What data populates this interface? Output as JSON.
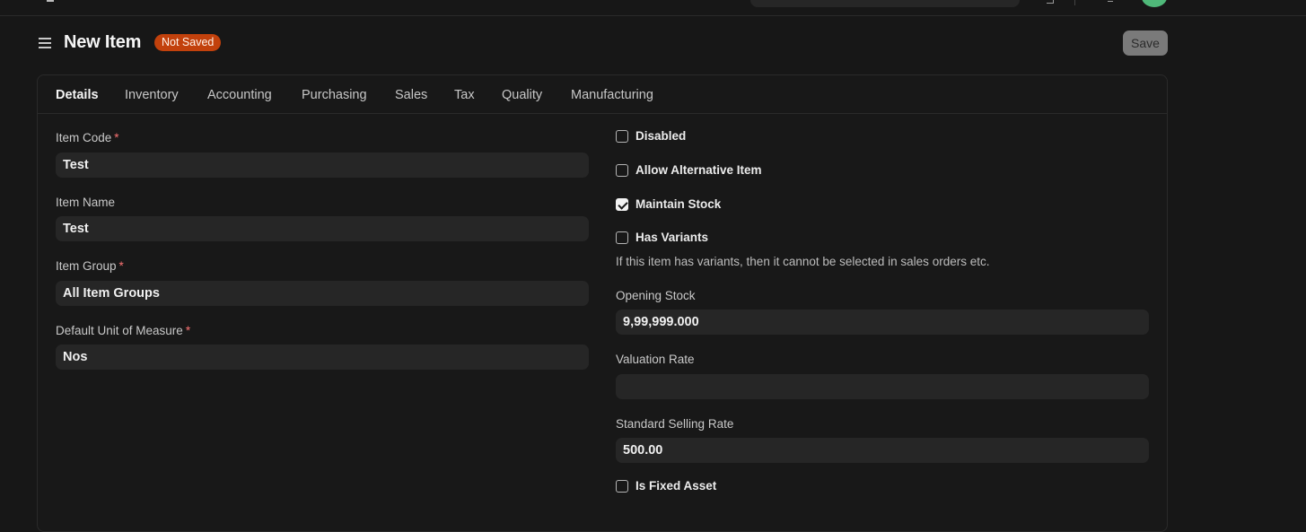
{
  "header": {
    "title": "New Item",
    "status": "Not Saved",
    "save_label": "Save"
  },
  "tabs": [
    {
      "label": "Details",
      "active": true
    },
    {
      "label": "Inventory"
    },
    {
      "label": "Accounting"
    },
    {
      "label": "Purchasing"
    },
    {
      "label": "Sales"
    },
    {
      "label": "Tax"
    },
    {
      "label": "Quality"
    },
    {
      "label": "Manufacturing"
    }
  ],
  "left_fields": {
    "item_code": {
      "label": "Item Code",
      "value": "Test",
      "required": "*"
    },
    "item_name": {
      "label": "Item Name",
      "value": "Test"
    },
    "item_group": {
      "label": "Item Group",
      "value": "All Item Groups",
      "required": "*"
    },
    "uom": {
      "label": "Default Unit of Measure",
      "value": "Nos",
      "required": "*"
    }
  },
  "right_fields": {
    "disabled": {
      "label": "Disabled",
      "checked": false
    },
    "allow_alternative": {
      "label": "Allow Alternative Item",
      "checked": false
    },
    "maintain_stock": {
      "label": "Maintain Stock",
      "checked": true
    },
    "has_variants": {
      "label": "Has Variants",
      "checked": false,
      "help": "If this item has variants, then it cannot be selected in sales orders etc."
    },
    "opening_stock": {
      "label": "Opening Stock",
      "value": "9,99,999.000"
    },
    "valuation_rate": {
      "label": "Valuation Rate",
      "value": ""
    },
    "standard_selling_rate": {
      "label": "Standard Selling Rate",
      "value": "500.00"
    },
    "is_fixed_asset": {
      "label": "Is Fixed Asset",
      "checked": false
    }
  },
  "colors": {
    "background": "#171717",
    "input_bg": "#262626",
    "status_badge": "#c2410c",
    "required": "#f87171",
    "avatar": "#4fb879"
  }
}
